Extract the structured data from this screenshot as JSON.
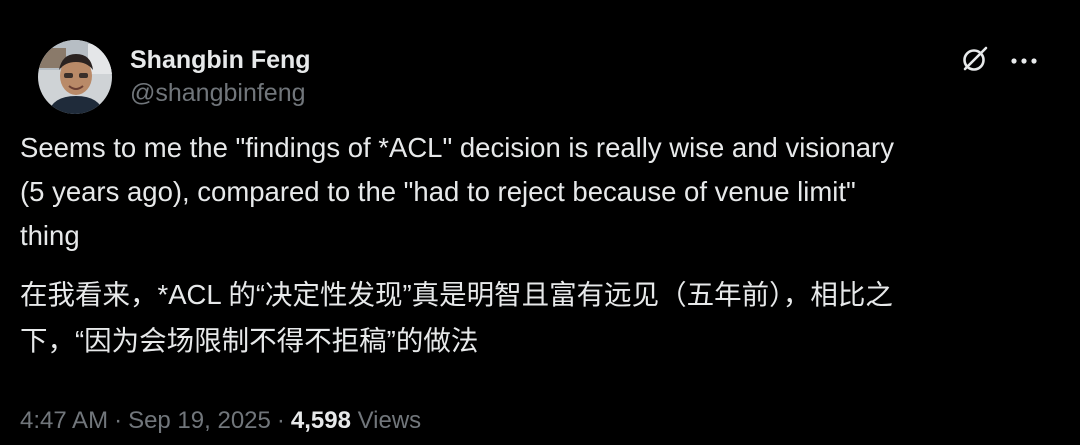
{
  "author": {
    "display_name": "Shangbin Feng",
    "handle": "@shangbinfeng"
  },
  "actions": {
    "grok_icon": "grok-icon",
    "more_icon": "more-icon",
    "more_label": "···"
  },
  "post": {
    "text_en": "Seems to me the \"findings of *ACL\" decision is really wise and visionary\n(5 years ago), compared to the \"had to reject because of venue limit\"\nthing",
    "text_zh": "在我看来，*ACL 的“决定性发现”真是明智且富有远见（五年前），相比之\n下，“因为会场限制不得不拒稿”的做法"
  },
  "meta": {
    "time": "4:47 AM",
    "separator": "·",
    "date": "Sep 19, 2025",
    "views_count": "4,598",
    "views_label": "Views"
  },
  "colors": {
    "background": "#000000",
    "primary_text": "#e7e9ea",
    "secondary_text": "#71767b"
  }
}
